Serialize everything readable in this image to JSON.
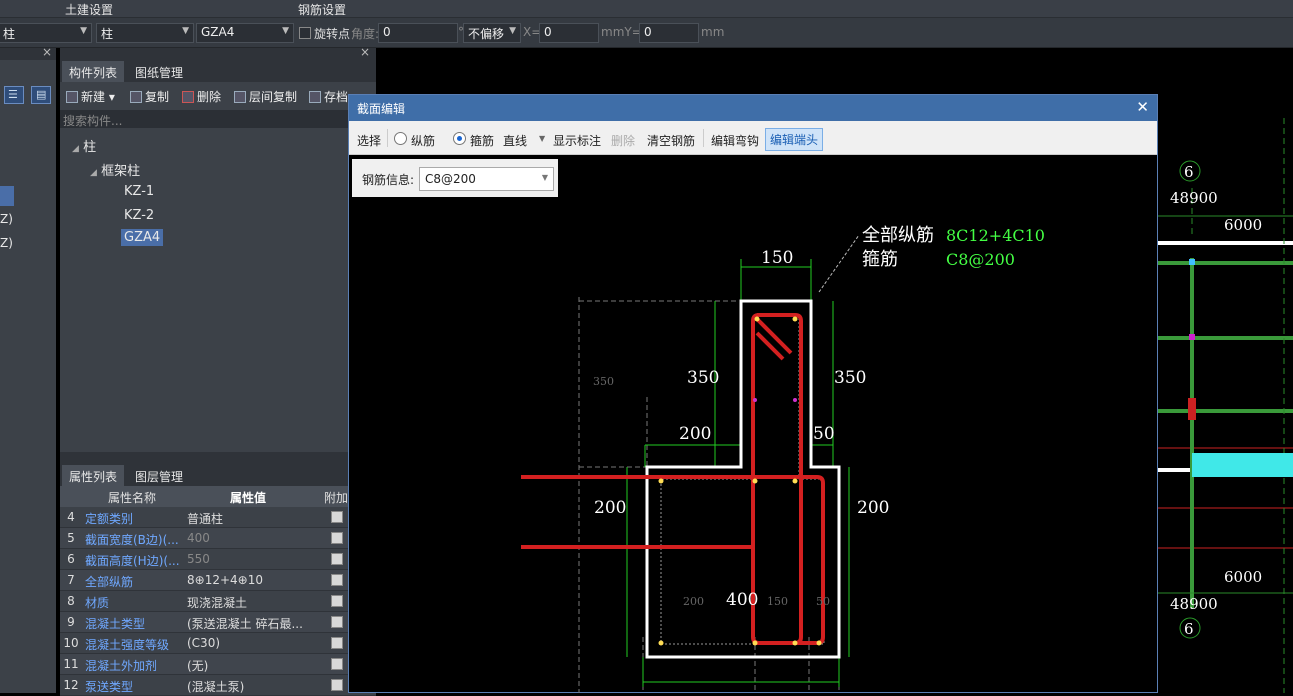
{
  "ribbon": {
    "tab_civil": "土建设置",
    "tab_rebar": "钢筋设置"
  },
  "toolbar": {
    "type_select": "柱",
    "subtype_select": "柱",
    "component_select": "GZA4",
    "rotate_label": "旋转点",
    "angle_label": "角度:",
    "angle_value": "0",
    "degree_unit": "°",
    "offset_select": "不偏移",
    "x_label": "X=",
    "x_value": "0",
    "y_label": "mmY=",
    "y_value": "0",
    "mm_unit": "mm"
  },
  "leftstrip": {
    "item1": "Z)",
    "item2": "Z)"
  },
  "component_panel": {
    "tab_list": "构件列表",
    "tab_drawing": "图纸管理",
    "btn_new": "新建",
    "btn_copy": "复制",
    "btn_delete": "删除",
    "btn_floorcopy": "层间复制",
    "btn_save": "存档",
    "search_placeholder": "搜索构件...",
    "tree_root": "柱",
    "tree_group": "框架柱",
    "tree_items": [
      "KZ-1",
      "KZ-2",
      "GZA4"
    ]
  },
  "property_panel": {
    "tab_props": "属性列表",
    "tab_layers": "图层管理",
    "col_name": "属性名称",
    "col_value": "属性值",
    "col_extra": "附加",
    "rows": [
      {
        "num": "4",
        "name": "定额类别",
        "value": "普通柱",
        "dim": false
      },
      {
        "num": "5",
        "name": "截面宽度(B边)(...",
        "value": "400",
        "dim": true
      },
      {
        "num": "6",
        "name": "截面高度(H边)(...",
        "value": "550",
        "dim": true
      },
      {
        "num": "7",
        "name": "全部纵筋",
        "value": "8⊕12+4⊕10",
        "dim": false
      },
      {
        "num": "8",
        "name": "材质",
        "value": "现浇混凝土",
        "dim": false
      },
      {
        "num": "9",
        "name": "混凝土类型",
        "value": "(泵送混凝土 碎石最...",
        "dim": false
      },
      {
        "num": "10",
        "name": "混凝土强度等级",
        "value": "(C30)",
        "dim": false
      },
      {
        "num": "11",
        "name": "混凝土外加剂",
        "value": "(无)",
        "dim": false
      },
      {
        "num": "12",
        "name": "泵送类型",
        "value": "(混凝土泵)",
        "dim": false
      }
    ]
  },
  "dialog": {
    "title": "截面编辑",
    "tool_select": "选择",
    "tool_longbar": "纵筋",
    "tool_stirrup": "箍筋",
    "tool_line": "直线",
    "tool_showlabel": "显示标注",
    "tool_delete": "删除",
    "tool_clear": "清空钢筋",
    "tool_edithook": "编辑弯钩",
    "tool_editend": "编辑端头",
    "rebar_info_label": "钢筋信息:",
    "rebar_info_value": "C8@200"
  },
  "drawing": {
    "label_all_long": "全部纵筋",
    "value_all_long": "8C12+4C10",
    "label_stirrup": "箍筋",
    "value_stirrup": "C8@200",
    "dim_top": "150",
    "dim_left_upper": "350",
    "dim_right_upper": "350",
    "dim_left_ledge": "200",
    "dim_right_ledge": "50",
    "dim_left_lower": "200",
    "dim_right_lower": "200",
    "dim_bottom": "400",
    "dim_far_left": "350",
    "dim_bottom_a": "200",
    "dim_bottom_b": "150",
    "dim_bottom_c": "50"
  },
  "background_plan": {
    "axis_top": "6",
    "axis_bottom": "6",
    "dim_total_top": "48900",
    "dim_span_top": "6000",
    "dim_span_bottom": "6000",
    "dim_total_bottom": "48900"
  }
}
